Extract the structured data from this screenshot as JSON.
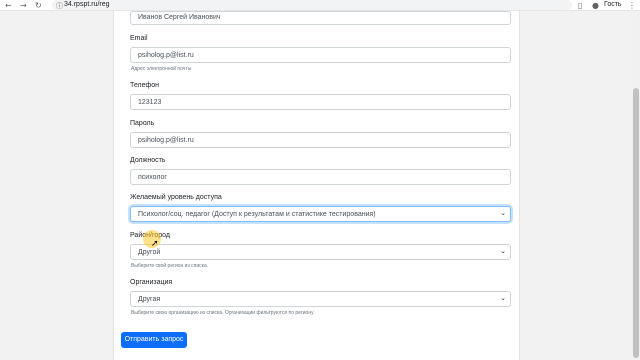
{
  "browser": {
    "url": "34.rpspt.ru/reg",
    "guest_label": "Гость",
    "back_icon": "←",
    "forward_icon": "→",
    "reload_icon": "↻",
    "lock_icon": "ⓘ",
    "menu_icon": "⋮",
    "sidebar_icon": "▯",
    "profile_icon": "●"
  },
  "form": {
    "fio_value": "Иванов Сергей Иванович",
    "email_label": "Email",
    "email_value": "psiholog.p@list.ru",
    "email_help": "Адрес электронной почты",
    "phone_label": "Телефон",
    "phone_value": "123123",
    "password_label": "Пароль",
    "password_value": "psiholog.p@list.ru",
    "position_label": "Должность",
    "position_value": "психолог",
    "access_label": "Желаемый уровень доступа",
    "access_value": "Психолог/соц. педагог (Доступ к результатам и статистике тестирования)",
    "district_label": "Район/город",
    "district_value": "Другой",
    "district_help": "Выберите свой регион из списка.",
    "org_label": "Организация",
    "org_value": "Другая",
    "org_help": "Выберите свою организацию из списка. Организации фильтруются по региону",
    "submit_label": "Отправить запрос",
    "chevron_icon": "⌄"
  },
  "colors": {
    "primary": "#0d6efd",
    "focus": "#80bdff"
  }
}
